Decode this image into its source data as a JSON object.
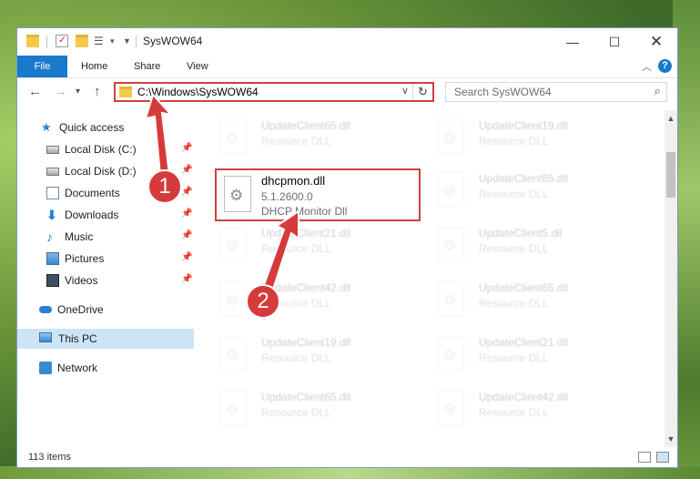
{
  "window": {
    "title": "SysWOW64"
  },
  "ribbon": {
    "tabs": [
      "File",
      "Home",
      "Share",
      "View"
    ]
  },
  "address": {
    "path": "C:\\Windows\\SysWOW64",
    "search_placeholder": "Search SysWOW64"
  },
  "nav": {
    "items": [
      {
        "label": "Quick access",
        "icon": "star-icon",
        "pinned": false
      },
      {
        "label": "Local Disk (C:)",
        "icon": "disk-icon",
        "pinned": true
      },
      {
        "label": "Local Disk (D:)",
        "icon": "disk-icon",
        "pinned": true
      },
      {
        "label": "Documents",
        "icon": "documents-icon",
        "pinned": true
      },
      {
        "label": "Downloads",
        "icon": "downloads-icon",
        "pinned": true
      },
      {
        "label": "Music",
        "icon": "music-icon",
        "pinned": true
      },
      {
        "label": "Pictures",
        "icon": "pictures-icon",
        "pinned": true
      },
      {
        "label": "Videos",
        "icon": "videos-icon",
        "pinned": true
      },
      {
        "label": "OneDrive",
        "icon": "onedrive-icon",
        "pinned": false
      },
      {
        "label": "This PC",
        "icon": "pc-icon",
        "pinned": false,
        "selected": true
      },
      {
        "label": "Network",
        "icon": "network-icon",
        "pinned": false
      }
    ]
  },
  "files": {
    "highlighted": {
      "name": "dhcpmon.dll",
      "version": "5.1.2600.0",
      "description": "DHCP Monitor Dll"
    },
    "left": [
      {
        "name": "UpdateClient65.dll",
        "desc": "Resource DLL"
      },
      {
        "name": "UpdateClient21.dll",
        "desc": "Resource DLL"
      },
      {
        "name": "UpdateClient42.dll",
        "desc": "Resource DLL"
      },
      {
        "name": "UpdateClient19.dll",
        "desc": "Resource DLL"
      },
      {
        "name": "UpdateClient65.dll",
        "desc": "Resource DLL"
      }
    ],
    "right": [
      {
        "name": "UpdateClient19.dll",
        "desc": "Resource DLL"
      },
      {
        "name": "UpdateClient65.dll",
        "desc": "Resource DLL"
      },
      {
        "name": "UpdateClient5.dll",
        "desc": "Resource DLL"
      },
      {
        "name": "UpdateClient65.dll",
        "desc": "Resource DLL"
      },
      {
        "name": "UpdateClient21.dll",
        "desc": "Resource DLL"
      },
      {
        "name": "UpdateClient42.dll",
        "desc": "Resource DLL"
      }
    ]
  },
  "status": {
    "item_count": "113 items"
  },
  "annotations": {
    "step1": "1",
    "step2": "2",
    "color": "#d63b3b"
  }
}
